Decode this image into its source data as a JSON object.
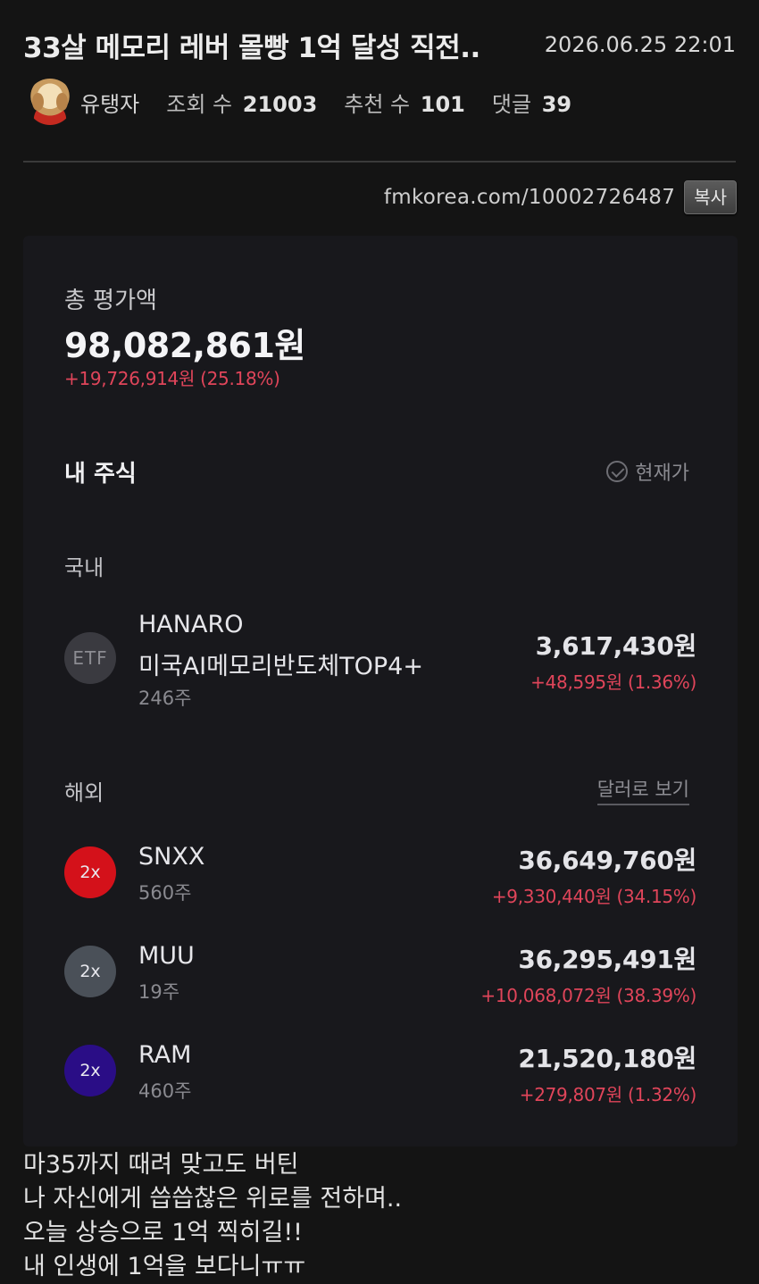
{
  "post": {
    "title": "33살 메모리 레버 몰빵 1억 달성 직전..",
    "date": "2026.06.25 22:01",
    "author": "유탱자",
    "views_label": "조회 수",
    "views": "21003",
    "likes_label": "추천 수",
    "likes": "101",
    "comments_label": "댓글",
    "comments": "39",
    "url": "fmkorea.com/10002726487",
    "copy_label": "복사"
  },
  "portfolio": {
    "total_label": "총 평가액",
    "total_value": "98,082,861원",
    "total_change": "+19,726,914원 (25.18%)",
    "my_stocks_label": "내 주식",
    "current_price_label": "현재가",
    "domestic_label": "국내",
    "overseas_label": "해외",
    "view_in_usd_label": "달러로 보기",
    "domestic": [
      {
        "badge": "ETF",
        "name_line1": "HANARO",
        "name_line2": "미국AI메모리반도체TOP4+",
        "qty": "246주",
        "value": "3,617,430원",
        "change": "+48,595원 (1.36%)",
        "badge_color": "#3a3a40"
      }
    ],
    "overseas": [
      {
        "badge": "2x",
        "name": "SNXX",
        "qty": "560주",
        "value": "36,649,760원",
        "change": "+9,330,440원 (34.15%)",
        "badge_color": "#d4111a"
      },
      {
        "badge": "2x",
        "name": "MUU",
        "qty": "19주",
        "value": "36,295,491원",
        "change": "+10,068,072원 (38.39%)",
        "badge_color": "#4a5058"
      },
      {
        "badge": "2x",
        "name": "RAM",
        "qty": "460주",
        "value": "21,520,180원",
        "change": "+279,807원 (1.32%)",
        "badge_color": "#2a0d86"
      }
    ]
  },
  "body": {
    "lines": [
      "마35까지 때려 맞고도 버틴",
      "나 자신에게 씁씁찮은 위로를 전하며..",
      "오늘 상승으로 1억 찍히길!!",
      "내 인생에 1억을 보다니ㅠㅠ"
    ]
  }
}
